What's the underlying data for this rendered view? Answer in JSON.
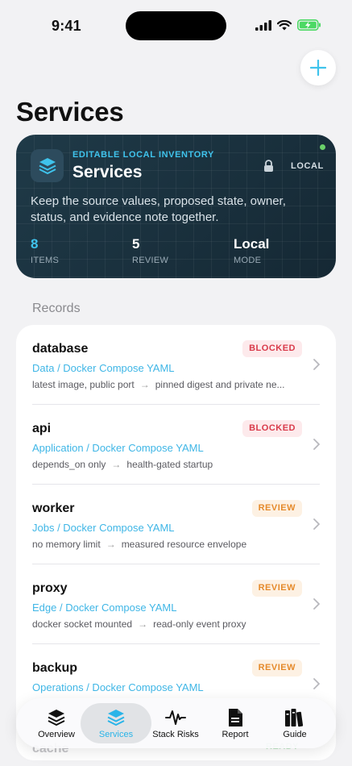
{
  "status_bar": {
    "time": "9:41"
  },
  "page": {
    "title": "Services"
  },
  "hero": {
    "eyebrow": "EDITABLE LOCAL INVENTORY",
    "title": "Services",
    "mode_badge": "LOCAL",
    "description": "Keep the source values, proposed state, owner, status, and evidence note together.",
    "stats": [
      {
        "value": "8",
        "label": "ITEMS"
      },
      {
        "value": "5",
        "label": "REVIEW"
      },
      {
        "value": "Local",
        "label": "MODE"
      }
    ]
  },
  "records": {
    "section_label": "Records",
    "items": [
      {
        "name": "database",
        "category": "Data / Docker Compose YAML",
        "from": "latest image, public port",
        "to": "pinned digest and private ne...",
        "status": "BLOCKED"
      },
      {
        "name": "api",
        "category": "Application / Docker Compose YAML",
        "from": "depends_on only",
        "to": "health-gated startup",
        "status": "BLOCKED"
      },
      {
        "name": "worker",
        "category": "Jobs / Docker Compose YAML",
        "from": "no memory limit",
        "to": "measured resource envelope",
        "status": "REVIEW"
      },
      {
        "name": "proxy",
        "category": "Edge / Docker Compose YAML",
        "from": "docker socket mounted",
        "to": "read-only event proxy",
        "status": "REVIEW"
      },
      {
        "name": "backup",
        "category": "Operations / Docker Compose YAML",
        "from": "",
        "to": "",
        "status": "REVIEW"
      }
    ],
    "partial_next": {
      "name": "cache",
      "status": "READY"
    }
  },
  "tabbar": {
    "tabs": [
      {
        "label": "Overview",
        "icon": "layers-icon"
      },
      {
        "label": "Services",
        "icon": "layers-filled-icon",
        "active": true
      },
      {
        "label": "Stack Risks",
        "icon": "waveform-icon"
      },
      {
        "label": "Report",
        "icon": "document-icon"
      },
      {
        "label": "Guide",
        "icon": "books-icon"
      }
    ]
  },
  "colors": {
    "accent": "#29b4e8",
    "hero_bg": "#1e3442",
    "blocked": "#d93a4a",
    "review": "#e58a2b",
    "ready": "#46b35a"
  }
}
